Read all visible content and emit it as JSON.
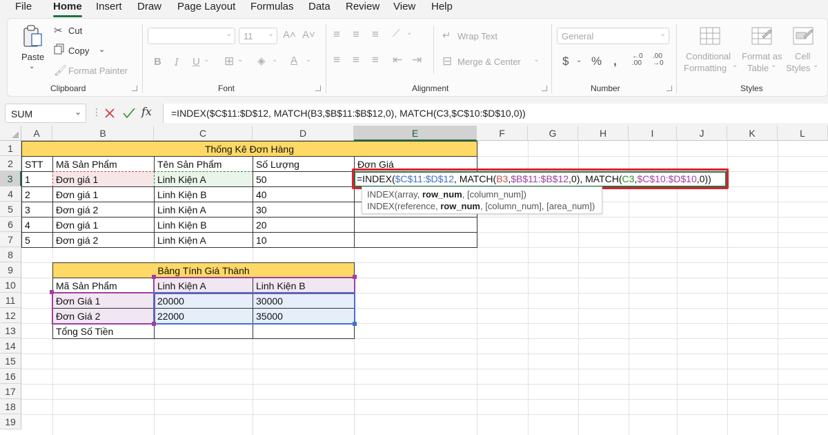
{
  "menu": [
    "File",
    "Home",
    "Insert",
    "Draw",
    "Page Layout",
    "Formulas",
    "Data",
    "Review",
    "View",
    "Help"
  ],
  "ribbon": {
    "clipboard": {
      "label": "Clipboard",
      "paste": "Paste",
      "cut": "Cut",
      "copy": "Copy",
      "format_painter": "Format Painter"
    },
    "font": {
      "label": "Font",
      "font_size": "11"
    },
    "alignment": {
      "label": "Alignment",
      "wrap_text": "Wrap Text",
      "merge_center": "Merge & Center"
    },
    "number": {
      "label": "Number",
      "format": "General"
    },
    "styles": {
      "label": "Styles",
      "conditional": "Conditional",
      "conditional2": "Formatting",
      "format_as": "Format as",
      "format_as2": "Table",
      "cell_styles": "Cell",
      "cell_styles2": "Styles"
    }
  },
  "formula_bar": {
    "name_box": "SUM",
    "formula": "=INDEX($C$11:$D$12, MATCH(B3,$B$11:$B$12,0), MATCH(C3,$C$10:$D$10,0))"
  },
  "columns": [
    "A",
    "B",
    "C",
    "D",
    "E",
    "F",
    "G",
    "H",
    "I",
    "J",
    "K",
    "L"
  ],
  "rows": [
    "1",
    "2",
    "3",
    "4",
    "5",
    "6",
    "7",
    "8",
    "9",
    "10",
    "11",
    "12",
    "13",
    "14",
    "15",
    "16",
    "17",
    "18",
    "19"
  ],
  "table1": {
    "title": "Thống Kê Đơn Hàng",
    "headers": [
      "STT",
      "Mã Sản Phẩm",
      "Tên Sản Phẩm",
      "Số Lượng",
      "Đơn Giá"
    ],
    "rows": [
      [
        "1",
        "Đơn giá 1",
        "Linh Kiện A",
        "50"
      ],
      [
        "2",
        "Đơn giá 1",
        "Linh Kiện B",
        "40"
      ],
      [
        "3",
        "Đơn giá 2",
        "Linh Kiện A",
        "30"
      ],
      [
        "4",
        "Đơn giá 1",
        "Linh Kiện B",
        "20"
      ],
      [
        "5",
        "Đơn giá 2",
        "Linh Kiện A",
        "10"
      ]
    ]
  },
  "table2": {
    "title": "Bảng Tính Giá Thành",
    "header": [
      "Mã Sản Phẩm",
      "Linh Kiện A",
      "Linh Kiện B"
    ],
    "rows": [
      [
        "Đơn Giá 1",
        "20000",
        "30000"
      ],
      [
        "Đơn Giá 2",
        "22000",
        "35000"
      ],
      [
        "Tổng Số Tiền",
        "",
        ""
      ]
    ]
  },
  "editing_cell": {
    "p1": "=INDEX(",
    "r1": "$C$11:$D$12",
    "p2": ", MATCH(",
    "r2": "B3",
    "p3": ",",
    "r3": "$B$11:$B$12",
    "p4": ",0), MATCH(",
    "r4": "C3",
    "p5": ",",
    "r5": "$C$10:$D$10",
    "p6": ",0))"
  },
  "tooltip": {
    "line1_a": "INDEX(array, ",
    "line1_b": "row_num",
    "line1_c": ", [column_num])",
    "line2_a": "INDEX(reference, ",
    "line2_b": "row_num",
    "line2_c": ", [column_num], [area_num])"
  },
  "colors": {
    "accent": "#217346",
    "ref_blue": "#4472c4",
    "ref_red": "#c0504d",
    "ref_purple": "#9e3fa0",
    "ref_green": "#2e8b2e",
    "highlight_box": "#e01e2a",
    "header_yellow": "#ffd966"
  }
}
